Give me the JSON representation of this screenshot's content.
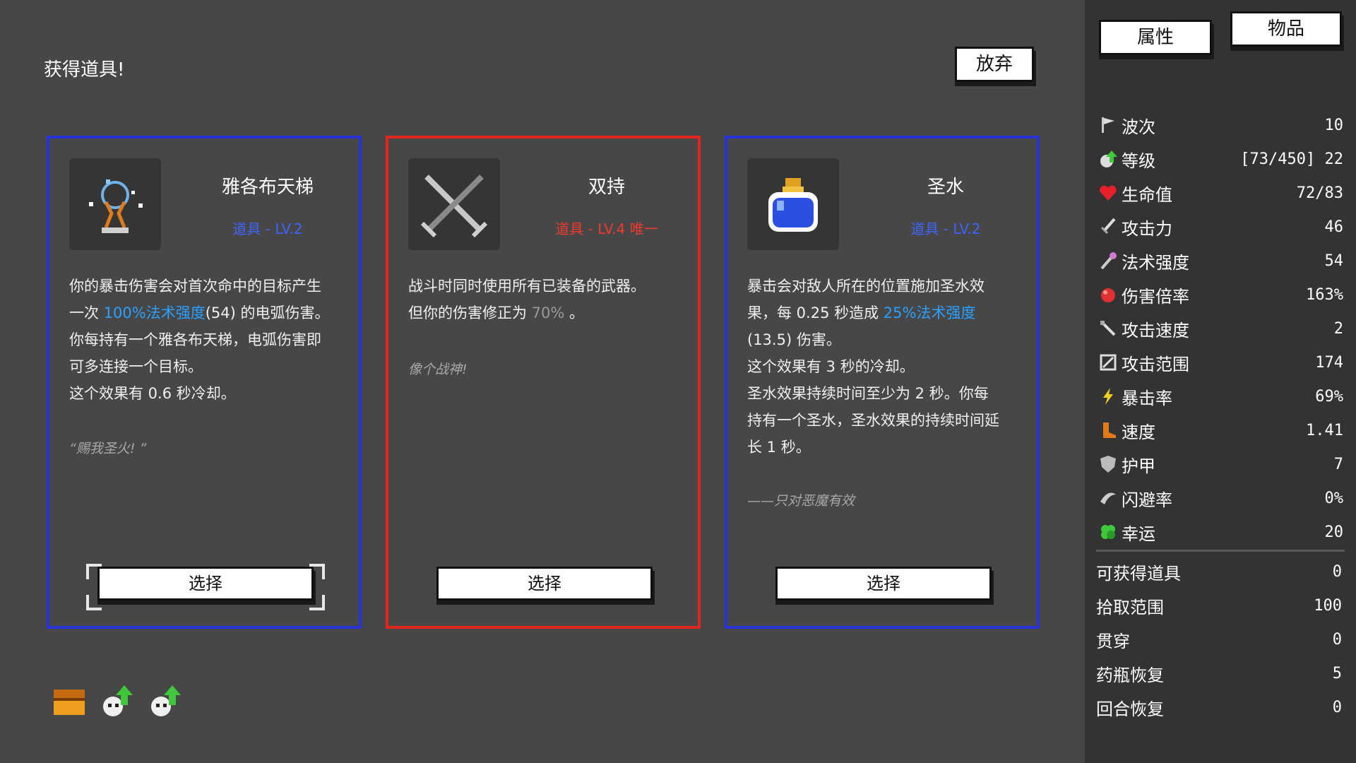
{
  "header": {
    "title": "获得道具!",
    "abandon_label": "放弃"
  },
  "cards": [
    {
      "name": "雅各布天梯",
      "tier": "道具 - LV.2",
      "desc_1": "你的暴击伤害会对首次命中的目标产生",
      "desc_2a": "一次 ",
      "desc_2_hl": "100%法术强度",
      "desc_2b": "(54) 的电弧伤害。",
      "desc_3": "你每持有一个雅各布天梯，电弧伤害即",
      "desc_4": "可多连接一个目标。",
      "desc_5": "这个效果有 0.6 秒冷却。",
      "quote": "“赐我圣火! ”",
      "select_label": "选择",
      "icon": "jacobs-ladder-icon",
      "border_color": "#2732d8"
    },
    {
      "name": "双持",
      "tier": "道具 - LV.4 唯一",
      "desc_1": "战斗时同时使用所有已装备的武器。",
      "desc_2a": "但你的伤害修正为 ",
      "desc_2_dim": "70%",
      "desc_2b": " 。",
      "quote": "像个战神!",
      "select_label": "选择",
      "icon": "crossed-swords-icon",
      "border_color": "#e2261e"
    },
    {
      "name": "圣水",
      "tier": "道具 - LV.2",
      "desc_1": "暴击会对敌人所在的位置施加圣水效",
      "desc_2a": "果，每 0.25 秒造成 ",
      "desc_2_hl": "25%法术强度",
      "desc_3": "(13.5) 伤害。",
      "desc_4": "这个效果有 3 秒的冷却。",
      "desc_5": "圣水效果持续时间至少为 2 秒。你每",
      "desc_6": "持有一个圣水，圣水效果的持续时间延",
      "desc_7": "长 1 秒。",
      "quote": "——只对恶魔有效",
      "select_label": "选择",
      "icon": "holy-water-bottle-icon",
      "border_color": "#2732d8"
    }
  ],
  "side": {
    "tab_attr": "属性",
    "tab_items": "物品",
    "stats": [
      {
        "label": "波次",
        "value": "10",
        "icon": "flag-icon"
      },
      {
        "label": "等级",
        "value": "[73/450] 22",
        "icon": "level-up-icon"
      },
      {
        "label": "生命值",
        "value": "72/83",
        "icon": "heart-icon"
      },
      {
        "label": "攻击力",
        "value": "46",
        "icon": "sword-icon"
      },
      {
        "label": "法术强度",
        "value": "54",
        "icon": "wand-icon"
      },
      {
        "label": "伤害倍率",
        "value": "163%",
        "icon": "damage-orb-icon"
      },
      {
        "label": "攻击速度",
        "value": "2",
        "icon": "attack-speed-icon"
      },
      {
        "label": "攻击范围",
        "value": "174",
        "icon": "range-icon"
      },
      {
        "label": "暴击率",
        "value": "69%",
        "icon": "lightning-icon"
      },
      {
        "label": "速度",
        "value": "1.41",
        "icon": "boot-icon"
      },
      {
        "label": "护甲",
        "value": "7",
        "icon": "shield-icon"
      },
      {
        "label": "闪避率",
        "value": "0%",
        "icon": "dodge-icon"
      },
      {
        "label": "幸运",
        "value": "20",
        "icon": "clover-icon"
      }
    ],
    "extra_stats": [
      {
        "label": "可获得道具",
        "value": "0"
      },
      {
        "label": "拾取范围",
        "value": "100"
      },
      {
        "label": "贯穿",
        "value": "0"
      },
      {
        "label": "药瓶恢复",
        "value": "5"
      },
      {
        "label": "回合恢复",
        "value": "0"
      }
    ]
  },
  "inventory": [
    "chest-icon",
    "skull-upgrade-icon",
    "skull-upgrade-icon"
  ]
}
